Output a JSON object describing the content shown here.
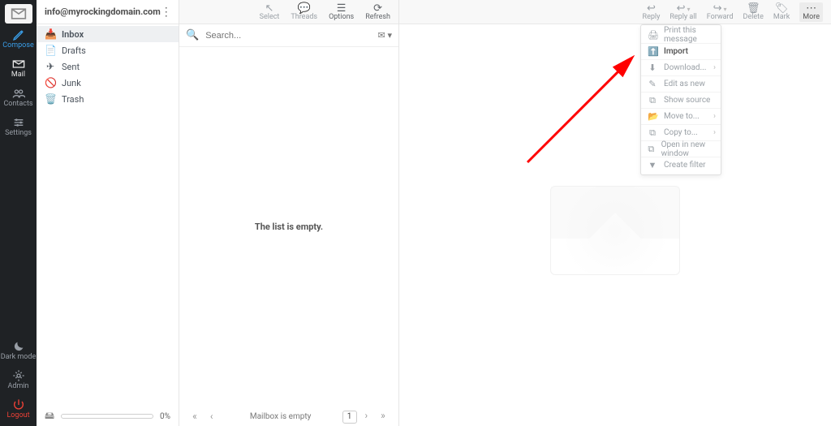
{
  "taskbar": {
    "compose": "Compose",
    "mail": "Mail",
    "contacts": "Contacts",
    "settings": "Settings",
    "darkmode": "Dark mode",
    "admin": "Admin",
    "logout": "Logout"
  },
  "account": {
    "email": "info@myrockingdomain.com"
  },
  "folders": [
    {
      "glyph": "📥",
      "name": "Inbox",
      "selected": true
    },
    {
      "glyph": "📄",
      "name": "Drafts",
      "selected": false
    },
    {
      "glyph": "✈",
      "name": "Sent",
      "selected": false
    },
    {
      "glyph": "🚫",
      "name": "Junk",
      "selected": false
    },
    {
      "glyph": "🗑️",
      "name": "Trash",
      "selected": false
    }
  ],
  "quota": {
    "percent": "0%"
  },
  "list_toolbar": {
    "select": "Select",
    "threads": "Threads",
    "options": "Options",
    "refresh": "Refresh"
  },
  "search": {
    "placeholder": "Search..."
  },
  "list": {
    "empty": "The list is empty."
  },
  "list_footer": {
    "status": "Mailbox is empty",
    "page": "1"
  },
  "msg_toolbar": {
    "reply": "Reply",
    "replyall": "Reply all",
    "forward": "Forward",
    "delete": "Delete",
    "mark": "Mark",
    "more": "More"
  },
  "more_menu": [
    {
      "icon": "🖨",
      "label": "Print this message",
      "enabled": false,
      "sub": false
    },
    {
      "icon": "⬆️",
      "label": "Import",
      "enabled": true,
      "sub": false
    },
    {
      "icon": "⬇",
      "label": "Download...",
      "enabled": false,
      "sub": true
    },
    {
      "icon": "✎",
      "label": "Edit as new",
      "enabled": false,
      "sub": false
    },
    {
      "icon": "⧉",
      "label": "Show source",
      "enabled": false,
      "sub": false
    },
    {
      "icon": "📂",
      "label": "Move to...",
      "enabled": false,
      "sub": true
    },
    {
      "icon": "⧉",
      "label": "Copy to...",
      "enabled": false,
      "sub": true
    },
    {
      "icon": "⧉",
      "label": "Open in new window",
      "enabled": false,
      "sub": false
    },
    {
      "icon": "▼",
      "label": "Create filter",
      "enabled": false,
      "sub": false
    }
  ]
}
